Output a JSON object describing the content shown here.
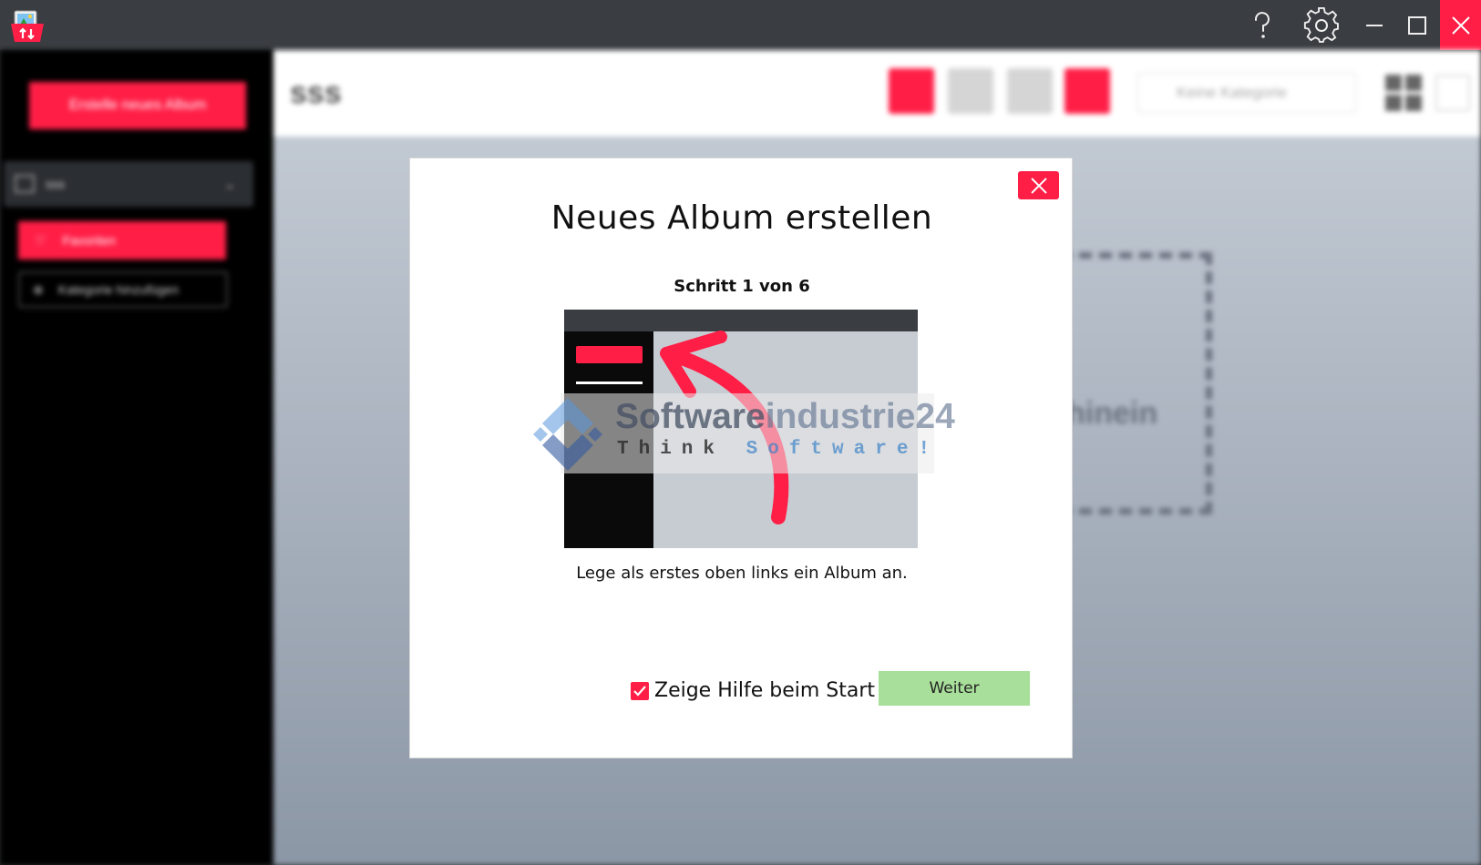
{
  "colors": {
    "accent": "#ff1e46",
    "next_button": "#a8df9a",
    "titlebar": "#3a3d41"
  },
  "titlebar": {
    "icons": [
      "app-logo-icon",
      "help-icon",
      "settings-icon",
      "minimize-icon",
      "maximize-icon",
      "close-icon"
    ]
  },
  "sidebar": {
    "create_album": "Erstelle neues Album",
    "group_label": "sss",
    "favorites": "Favoriten",
    "add_category": "Kategorie hinzufügen"
  },
  "main": {
    "album_title": "sss",
    "category_select": "Keine Kategorie",
    "drop_text": "hinein"
  },
  "dialog": {
    "title": "Neues Album erstellen",
    "step": "Schritt 1 von 6",
    "description": "Lege als erstes oben links ein Album an.",
    "show_help_label": "Zeige Hilfe beim Start",
    "show_help_checked": true,
    "next_button": "Weiter"
  },
  "watermark": {
    "name_part1": "Software",
    "name_part2": "industrie24",
    "slogan_part1": "Think",
    "slogan_part2": "Software!"
  }
}
